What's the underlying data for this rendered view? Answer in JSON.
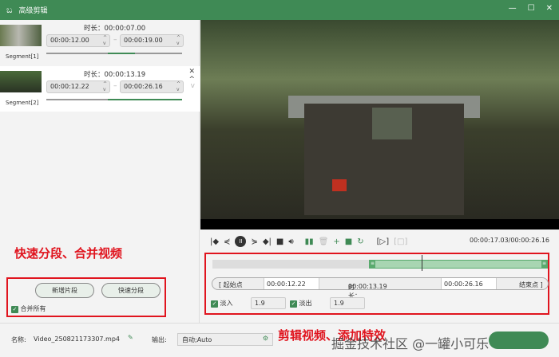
{
  "window": {
    "title": "高级剪辑",
    "logo": "ಬ",
    "minimize": "—",
    "maximize": "☐",
    "close": "✕"
  },
  "segments": [
    {
      "label": "Segment[1]",
      "duration_label": "时长：",
      "duration": "00:00:07.00",
      "start": "00:00:12.00",
      "end": "00:00:19.00",
      "selected": false,
      "bar_start": 0.45,
      "bar_end": 0.65
    },
    {
      "label": "Segment[2]",
      "duration_label": "时长：",
      "duration": "00:00:13.19",
      "start": "00:00:12.22",
      "end": "00:00:26.16",
      "selected": true,
      "bar_start": 0.45,
      "bar_end": 1.0
    }
  ],
  "left_actions": {
    "add_segment": "新增片段",
    "quick_split": "快速分段",
    "merge_all": "合并所有",
    "merge_all_checked": true
  },
  "annotations": {
    "left": "快速分段、合并视频",
    "bottom": "剪辑视频、添加特效"
  },
  "player": {
    "timecode": "00:00:17.03/00:00:26.16",
    "playhead_fraction": 0.63
  },
  "trim": {
    "start_btn": "[ 起始点",
    "start": "00:00:12.22",
    "duration_label": "时长：",
    "duration": "00:00:13.19",
    "end": "00:00:26.16",
    "end_btn": "结束点 ]",
    "range_start_fraction": 0.465,
    "range_end_fraction": 1.0
  },
  "fade": {
    "fade_in_label": "淡入",
    "fade_in": "1.9",
    "fade_in_checked": true,
    "fade_out_label": "淡出",
    "fade_out": "1.9",
    "fade_out_checked": true
  },
  "footer": {
    "name_label": "名称:",
    "name": "Video_250821173307.mp4",
    "output_label": "输出:",
    "output": "自动;Auto"
  },
  "watermark": "掘金技术社区 @一罐小可乐",
  "colors": {
    "accent": "#3f8a55",
    "annotation": "#e0141e"
  }
}
